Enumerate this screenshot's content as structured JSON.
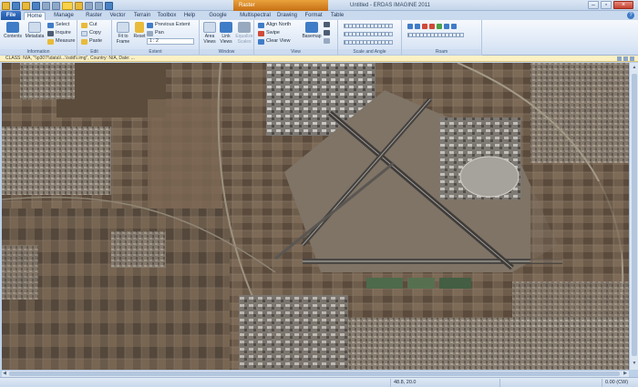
{
  "titlebar": {
    "app_title": "Untitled - ERDAS IMAGINE 2011",
    "context_tab": "Raster"
  },
  "tabs": [
    "File",
    "Home",
    "Manage Data",
    "Raster",
    "Vector",
    "Terrain",
    "Toolbox",
    "Help",
    "Google Earth",
    "Multispectral",
    "Drawing",
    "Format",
    "Table"
  ],
  "ribbon": {
    "information": {
      "label": "Information",
      "contents": "Contents",
      "metadata": "Metadata",
      "select": "Select",
      "inquire": "Inquire",
      "measure": "Measure"
    },
    "edit": {
      "label": "Edit",
      "cut": "Cut",
      "copy": "Copy",
      "paste": "Paste"
    },
    "extent": {
      "label": "Extent",
      "fit_to": "Fit to",
      "frame": "Frame",
      "reset": "Reset",
      "previous_extent": "Previous Extent",
      "pan": "Pan",
      "scale_value": "1 : 2"
    },
    "window": {
      "label": "Window",
      "area": "Area",
      "link": "Link",
      "views": "Views",
      "views2": "Views",
      "equalize": "Equalize",
      "scales": "Scales"
    },
    "view": {
      "label": "View",
      "align_north": "Align North",
      "swipe": "Swipe",
      "clear_view": "Clear View",
      "basemap": "Basemap"
    },
    "scale_angle": {
      "label": "Scale and Angle"
    },
    "roam": {
      "label": "Roam"
    }
  },
  "infobar": {
    "text": "CLASS: N/A, \"\\\\p307\\\\data\\\\...\\\\sdd\\\\.img\", Country: N/A, Date: ..."
  },
  "status": {
    "coords": "48.8, 20.0",
    "rotation": "0.00 (CW)"
  }
}
